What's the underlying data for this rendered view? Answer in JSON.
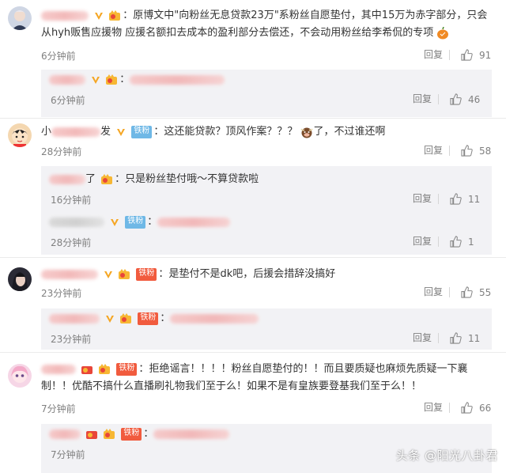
{
  "comments": [
    {
      "text": "原博文中\"向粉丝无息贷款23万\"系粉丝自愿垫付，其中15万为赤字部分，只会从hyh贩售应援物 应援名额扣去成本的盈利部分去偿还，不会动用粉丝给李希侃的专项",
      "time": "6分钟前",
      "reply_label": "回复",
      "likes": "91",
      "reply": {
        "time": "6分钟前",
        "reply_label": "回复",
        "likes": "46"
      }
    },
    {
      "name_prefix": "小",
      "name_suffix": "发",
      "fan_badge": "铁粉",
      "text": "这还能贷款？顶风作案？？？",
      "text_after": "了，不过谁还啊",
      "time": "28分钟前",
      "reply_label": "回复",
      "likes": "58",
      "replies": [
        {
          "name_suffix": "了",
          "text": "只是粉丝垫付哦～不算贷款啦",
          "time": "16分钟前",
          "reply_label": "回复",
          "likes": "11"
        },
        {
          "fan_badge": "铁粉",
          "time": "28分钟前",
          "reply_label": "回复",
          "likes": "1"
        }
      ]
    },
    {
      "fan_badge": "铁粉",
      "text": "是垫付不是dk吧，后援会措辞没搞好",
      "time": "23分钟前",
      "reply_label": "回复",
      "likes": "55",
      "reply": {
        "fan_badge": "铁粉",
        "time": "23分钟前",
        "reply_label": "回复",
        "likes": "11"
      }
    },
    {
      "fan_badge": "铁粉",
      "text": "拒绝谣言！！！！粉丝自愿垫付的！！而且要质疑也麻烦先质疑一下襄制！！优酷不搞什么直播刷礼物我们至于么！如果不是有皇族要登基我们至于么！！",
      "time": "7分钟前",
      "reply_label": "回复",
      "likes": "66",
      "reply": {
        "fan_badge": "铁粉",
        "time": "7分钟前"
      }
    }
  ],
  "watermark": "头条 @阳光八卦君",
  "colors": {
    "text": "#333333",
    "muted": "#808080",
    "reply_bg": "#f2f2f5",
    "iron_badge": "#6fb8e6",
    "red_badge": "#f15b3e",
    "vip": "#f5a623"
  },
  "icons": [
    "thumbs-up-icon",
    "vip-v-icon",
    "crown-icon",
    "pumpkin-emoji",
    "ox-emoji"
  ]
}
